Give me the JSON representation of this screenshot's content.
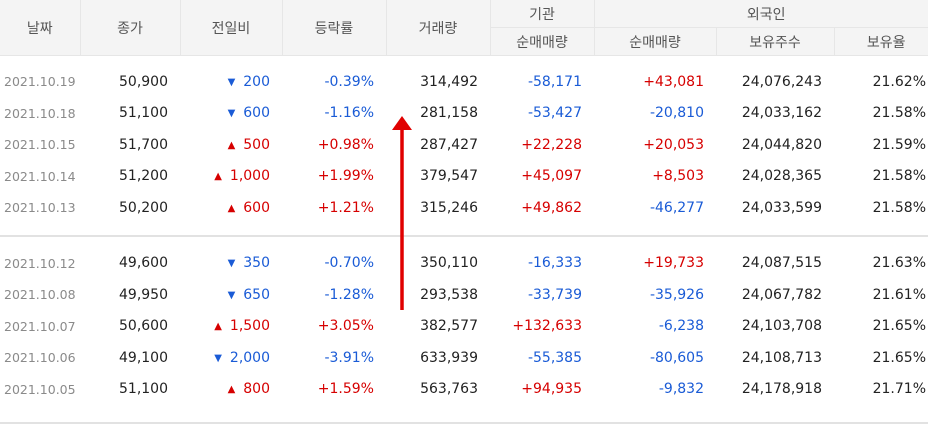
{
  "headers": {
    "date": "날짜",
    "close": "종가",
    "change": "전일비",
    "rate": "등락률",
    "volume": "거래량",
    "institution": "기관",
    "institution_net": "순매매량",
    "foreign": "외국인",
    "foreign_net": "순매매량",
    "foreign_holdings": "보유주수",
    "foreign_ratio": "보유율"
  },
  "colors": {
    "up": "#d60000",
    "down": "#1a5bd6",
    "arrow": "#e00000"
  },
  "rows": [
    {
      "date": "2021.10.19",
      "close": "50,900",
      "dir": "down",
      "change": "200",
      "rate": "-0.39%",
      "volume": "314,492",
      "inst": "-58,171",
      "frgn": "+43,081",
      "hold": "24,076,243",
      "ratio": "21.62%"
    },
    {
      "date": "2021.10.18",
      "close": "51,100",
      "dir": "down",
      "change": "600",
      "rate": "-1.16%",
      "volume": "281,158",
      "inst": "-53,427",
      "frgn": "-20,810",
      "hold": "24,033,162",
      "ratio": "21.58%"
    },
    {
      "date": "2021.10.15",
      "close": "51,700",
      "dir": "up",
      "change": "500",
      "rate": "+0.98%",
      "volume": "287,427",
      "inst": "+22,228",
      "frgn": "+20,053",
      "hold": "24,044,820",
      "ratio": "21.59%"
    },
    {
      "date": "2021.10.14",
      "close": "51,200",
      "dir": "up",
      "change": "1,000",
      "rate": "+1.99%",
      "volume": "379,547",
      "inst": "+45,097",
      "frgn": "+8,503",
      "hold": "24,028,365",
      "ratio": "21.58%"
    },
    {
      "date": "2021.10.13",
      "close": "50,200",
      "dir": "up",
      "change": "600",
      "rate": "+1.21%",
      "volume": "315,246",
      "inst": "+49,862",
      "frgn": "-46,277",
      "hold": "24,033,599",
      "ratio": "21.58%"
    },
    {
      "date": "2021.10.12",
      "close": "49,600",
      "dir": "down",
      "change": "350",
      "rate": "-0.70%",
      "volume": "350,110",
      "inst": "-16,333",
      "frgn": "+19,733",
      "hold": "24,087,515",
      "ratio": "21.63%"
    },
    {
      "date": "2021.10.08",
      "close": "49,950",
      "dir": "down",
      "change": "650",
      "rate": "-1.28%",
      "volume": "293,538",
      "inst": "-33,739",
      "frgn": "-35,926",
      "hold": "24,067,782",
      "ratio": "21.61%"
    },
    {
      "date": "2021.10.07",
      "close": "50,600",
      "dir": "up",
      "change": "1,500",
      "rate": "+3.05%",
      "volume": "382,577",
      "inst": "+132,633",
      "frgn": "-6,238",
      "hold": "24,103,708",
      "ratio": "21.65%"
    },
    {
      "date": "2021.10.06",
      "close": "49,100",
      "dir": "down",
      "change": "2,000",
      "rate": "-3.91%",
      "volume": "633,939",
      "inst": "-55,385",
      "frgn": "-80,605",
      "hold": "24,108,713",
      "ratio": "21.65%"
    },
    {
      "date": "2021.10.05",
      "close": "51,100",
      "dir": "up",
      "change": "800",
      "rate": "+1.59%",
      "volume": "563,763",
      "inst": "+94,935",
      "frgn": "-9,832",
      "hold": "24,178,918",
      "ratio": "21.71%"
    }
  ]
}
